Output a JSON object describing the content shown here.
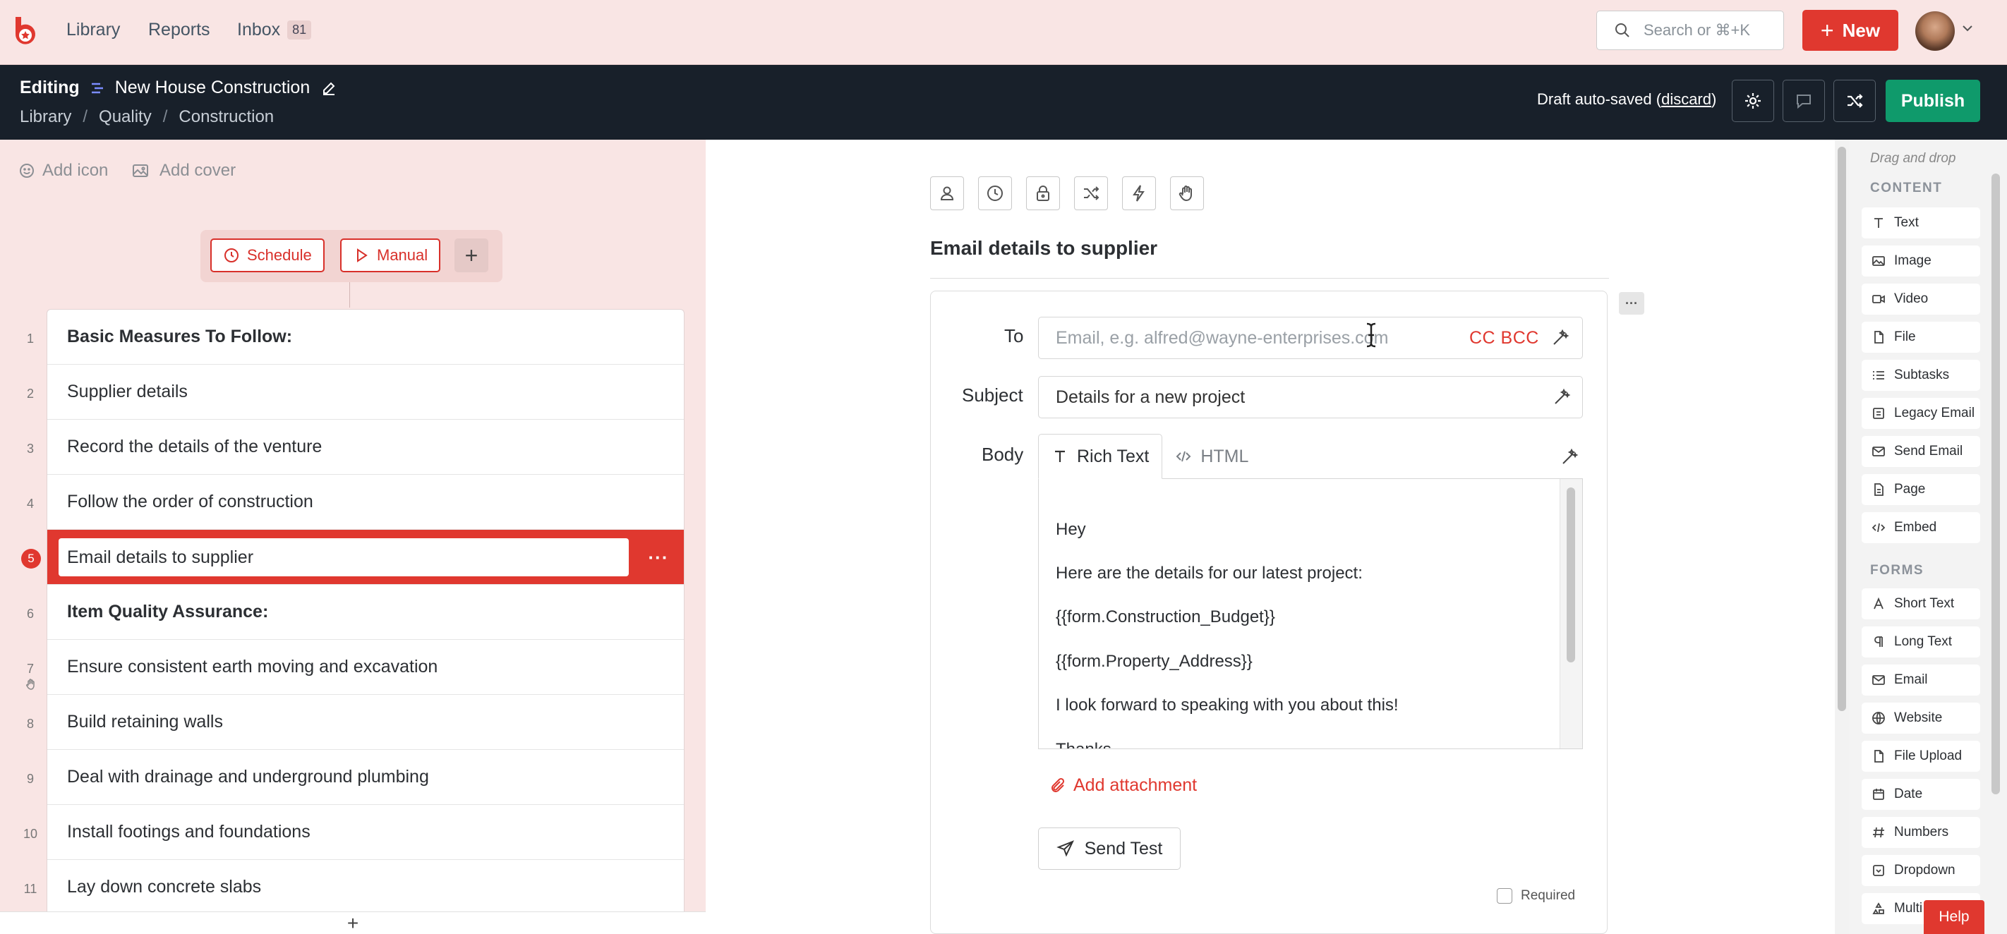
{
  "topbar": {
    "nav": [
      "Library",
      "Reports",
      "Inbox"
    ],
    "inbox_count": "81",
    "search_placeholder": "Search or ⌘+K",
    "new_label": "New"
  },
  "editbar": {
    "mode_label": "Editing",
    "workflow_name": "New House Construction",
    "breadcrumbs": [
      "Library",
      "Quality",
      "Construction"
    ],
    "draft_prefix": "Draft auto-saved (",
    "draft_link": "discard",
    "draft_suffix": ")",
    "publish_label": "Publish"
  },
  "left": {
    "add_icon": "Add icon",
    "add_cover": "Add cover",
    "triggers": {
      "schedule": "Schedule",
      "manual": "Manual"
    },
    "tasks": [
      {
        "num": "1",
        "label": "Basic Measures To Follow:",
        "heading": true
      },
      {
        "num": "2",
        "label": "Supplier details"
      },
      {
        "num": "3",
        "label": "Record the details of the venture"
      },
      {
        "num": "4",
        "label": "Follow the order of construction"
      },
      {
        "num": "5",
        "label": "Email details to supplier",
        "active": true
      },
      {
        "num": "6",
        "label": "Item Quality Assurance:",
        "heading": true
      },
      {
        "num": "7",
        "label": "Ensure consistent earth moving and excavation"
      },
      {
        "num": "8",
        "label": "Build retaining walls"
      },
      {
        "num": "9",
        "label": "Deal with drainage and underground plumbing"
      },
      {
        "num": "10",
        "label": "Install footings and foundations"
      },
      {
        "num": "11",
        "label": "Lay down concrete slabs"
      }
    ],
    "add_task": "+"
  },
  "main": {
    "task_title": "Email details to supplier",
    "to_label": "To",
    "to_placeholder": "Email, e.g. alfred@wayne-enterprises.com",
    "cc_bcc": "CC BCC",
    "subject_label": "Subject",
    "subject_value": "Details for a new project",
    "body_label": "Body",
    "tab_rich": "Rich Text",
    "tab_html": "HTML",
    "body_lines": [
      "Hey",
      "Here are the details for our latest project:",
      "{{form.Construction_Budget}}",
      "{{form.Property_Address}}",
      "I look forward to speaking with you about this!",
      "Thanks"
    ],
    "add_attachment": "Add attachment",
    "send_test": "Send Test",
    "required": "Required"
  },
  "palette": {
    "drag_drop": "Drag and drop",
    "content_header": "CONTENT",
    "content": [
      "Text",
      "Image",
      "Video",
      "File",
      "Subtasks",
      "Legacy Email",
      "Send Email",
      "Page",
      "Embed"
    ],
    "forms_header": "FORMS",
    "forms": [
      "Short Text",
      "Long Text",
      "Email",
      "Website",
      "File Upload",
      "Date",
      "Numbers",
      "Dropdown",
      "Multi"
    ]
  },
  "help": "Help",
  "colors": {
    "brand_red": "#e0382f",
    "publish_green": "#0f9a6b",
    "dark_bar": "#18202a",
    "pink_bg": "#f9e5e4"
  }
}
